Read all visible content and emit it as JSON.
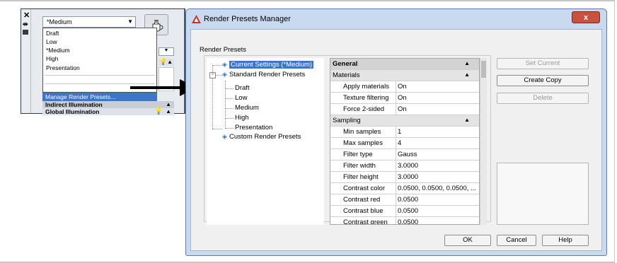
{
  "palette": {
    "current_preset": "*Medium",
    "dropdown_items": [
      "Draft",
      "Low",
      "*Medium",
      "High",
      "Presentation"
    ],
    "manage_item": "Manage Render Presets...",
    "rows": [
      "Indirect Illumination",
      "Global Illumination"
    ]
  },
  "dialog": {
    "title": "Render Presets Manager",
    "close_label": "x",
    "group_label": "Render Presets",
    "tree": {
      "current": "Current Settings (*Medium)",
      "standard": "Standard Render Presets",
      "children": [
        "Draft",
        "Low",
        "Medium",
        "High",
        "Presentation"
      ],
      "custom": "Custom Render Presets"
    },
    "properties": {
      "general_header": "General",
      "materials_header": "Materials",
      "materials": [
        {
          "label": "Apply materials",
          "value": "On"
        },
        {
          "label": "Texture filtering",
          "value": "On"
        },
        {
          "label": "Force 2-sided",
          "value": "On"
        }
      ],
      "sampling_header": "Sampling",
      "sampling": [
        {
          "label": "Min samples",
          "value": "1"
        },
        {
          "label": "Max samples",
          "value": "4"
        },
        {
          "label": "Filter type",
          "value": "Gauss"
        },
        {
          "label": "Filter width",
          "value": "3.0000"
        },
        {
          "label": "Filter height",
          "value": "3.0000"
        },
        {
          "label": "Contrast color",
          "value": "0.0500, 0.0500, 0.0500, ..."
        },
        {
          "label": "Contrast red",
          "value": "0.0500"
        },
        {
          "label": "Contrast blue",
          "value": "0.0500"
        },
        {
          "label": "Contrast green",
          "value": "0.0500"
        }
      ]
    },
    "buttons": {
      "set_current": "Set Current",
      "create_copy": "Create Copy",
      "delete": "Delete",
      "ok": "OK",
      "cancel": "Cancel",
      "help": "Help"
    }
  }
}
